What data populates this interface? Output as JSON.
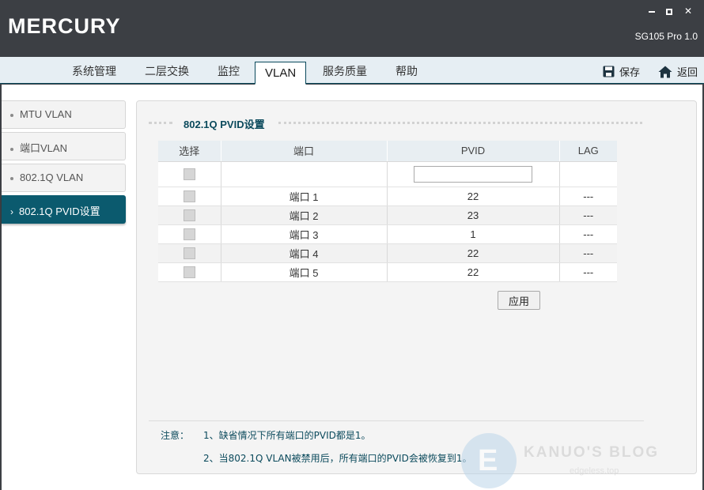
{
  "app": {
    "logo": "MERCURY",
    "model": "SG105 Pro 1.0"
  },
  "colors": {
    "titlebar_bg": "#3c3f44",
    "accent": "#0b5a6e",
    "menubar_bg": "#e6eef3",
    "note_text": "#0b4a5c"
  },
  "menu": {
    "tabs": [
      {
        "label": "系统管理"
      },
      {
        "label": "二层交换"
      },
      {
        "label": "监控"
      },
      {
        "label": "VLAN"
      },
      {
        "label": "服务质量"
      },
      {
        "label": "帮助"
      }
    ],
    "active_tab": "VLAN",
    "save_label": "保存",
    "back_label": "返回",
    "save_icon": "save-icon",
    "back_icon": "home-icon"
  },
  "sidebar": {
    "items": [
      {
        "label": "MTU VLAN"
      },
      {
        "label": "端口VLAN"
      },
      {
        "label": "802.1Q VLAN"
      },
      {
        "label": "802.1Q PVID设置"
      }
    ],
    "active_item": "802.1Q PVID设置"
  },
  "section": {
    "title": "802.1Q PVID设置"
  },
  "table": {
    "headers": [
      "选择",
      "端口",
      "PVID",
      "LAG"
    ],
    "filter_pvid_value": "",
    "rows": [
      {
        "port": "端口 1",
        "pvid": "22",
        "lag": "---"
      },
      {
        "port": "端口 2",
        "pvid": "23",
        "lag": "---"
      },
      {
        "port": "端口 3",
        "pvid": "1",
        "lag": "---"
      },
      {
        "port": "端口 4",
        "pvid": "22",
        "lag": "---"
      },
      {
        "port": "端口 5",
        "pvid": "22",
        "lag": "---"
      }
    ]
  },
  "apply_label": "应用",
  "note": {
    "head": "注意：",
    "items": [
      "1、缺省情况下所有端口的PVID都是1。",
      "2、当802.1Q VLAN被禁用后，所有端口的PVID会被恢复到1。"
    ]
  },
  "watermark": {
    "letter": "E",
    "text": "KANUO'S BLOG",
    "sub": "edgeless.top"
  }
}
